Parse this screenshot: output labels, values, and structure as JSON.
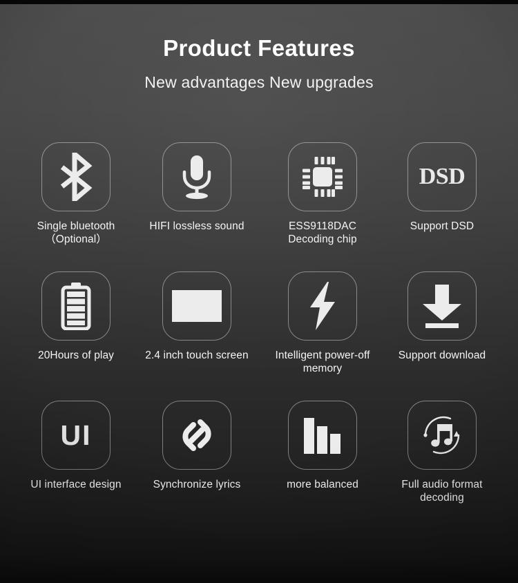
{
  "header": {
    "title": "Product Features",
    "subtitle": "New advantages  New upgrades"
  },
  "colors": {
    "background_top": "#4a4a4a",
    "background_bottom": "#0b0b0b",
    "text": "#f4f4f4",
    "icon": "#e9e9e9",
    "tile_border": "rgba(255,255,255,0.42)"
  },
  "features": [
    {
      "icon": "bluetooth-icon",
      "label": "Single bluetooth\n（Optional）"
    },
    {
      "icon": "microphone-icon",
      "label": "HIFI lossless sound"
    },
    {
      "icon": "chip-icon",
      "label": "ESS9118DAC\nDecoding chip"
    },
    {
      "icon": "dsd-text-icon",
      "label": "Support DSD",
      "glyph": "DSD"
    },
    {
      "icon": "battery-icon",
      "label": "20Hours of play"
    },
    {
      "icon": "screen-icon",
      "label": "2.4 inch touch screen"
    },
    {
      "icon": "lightning-bolt-icon",
      "label": "Intelligent power-off\nmemory"
    },
    {
      "icon": "download-icon",
      "label": "Support download"
    },
    {
      "icon": "ui-text-icon",
      "label": "UI interface design",
      "glyph": "UI"
    },
    {
      "icon": "link-icon",
      "label": "Synchronize lyrics"
    },
    {
      "icon": "bar-chart-icon",
      "label": "more balanced"
    },
    {
      "icon": "music-note-refresh-icon",
      "label": "Full audio format\ndecoding"
    }
  ]
}
